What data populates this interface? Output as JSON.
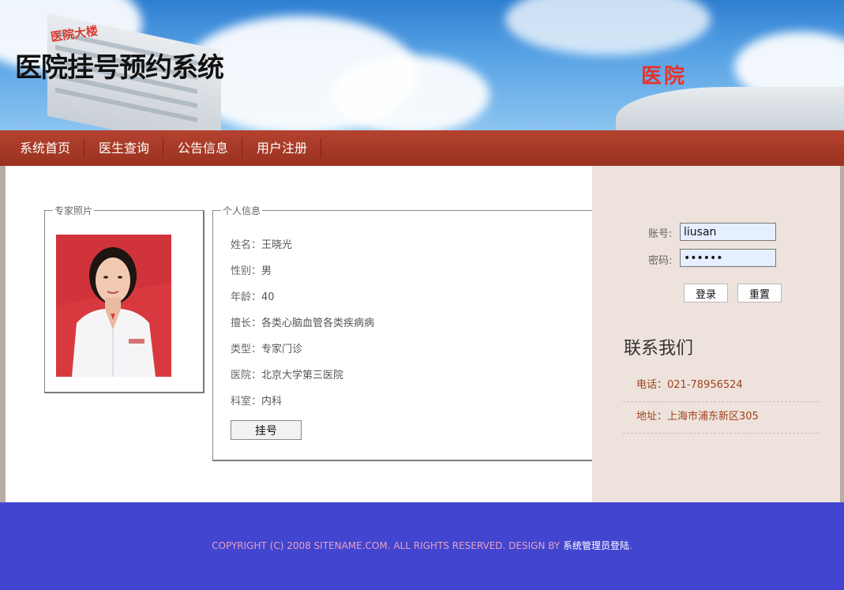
{
  "header": {
    "title": "医院挂号预约系统",
    "sign_text": "医院",
    "sign_left_text": "医院大楼"
  },
  "nav": {
    "items": [
      {
        "label": "系统首页"
      },
      {
        "label": "医生查询"
      },
      {
        "label": "公告信息"
      },
      {
        "label": "用户注册"
      }
    ]
  },
  "photo_box": {
    "legend": "专家照片"
  },
  "info_box": {
    "legend": "个人信息",
    "rows": [
      {
        "label": "姓名：",
        "value": "王晓光"
      },
      {
        "label": "性别：",
        "value": "男"
      },
      {
        "label": "年龄：",
        "value": "40"
      },
      {
        "label": "擅长：",
        "value": "各类心脑血管各类疾病病"
      },
      {
        "label": "类型：",
        "value": "专家门诊"
      },
      {
        "label": "医院：",
        "value": "北京大学第三医院"
      },
      {
        "label": "科室：",
        "value": "内科"
      }
    ],
    "book_button": "挂号"
  },
  "login": {
    "account_label": "账号:",
    "account_value": "liusan",
    "password_label": "密码:",
    "password_value": "liusan",
    "login_button": "登录",
    "reset_button": "重置"
  },
  "contact": {
    "title": "联系我们",
    "phone": "电话：021-78956524",
    "address": "地址：上海市浦东新区305"
  },
  "footer": {
    "copyright": "COPYRIGHT (C) 2008 SITENAME.COM. ALL RIGHTS RESERVED. DESIGN BY ",
    "admin_link": "系统管理员登陆",
    "suffix": "."
  },
  "colors": {
    "nav_bg": "#a63a27",
    "footer_bg": "#4145cf",
    "sidebar_bg": "#ede3dc",
    "contact_text": "#a0411f"
  }
}
